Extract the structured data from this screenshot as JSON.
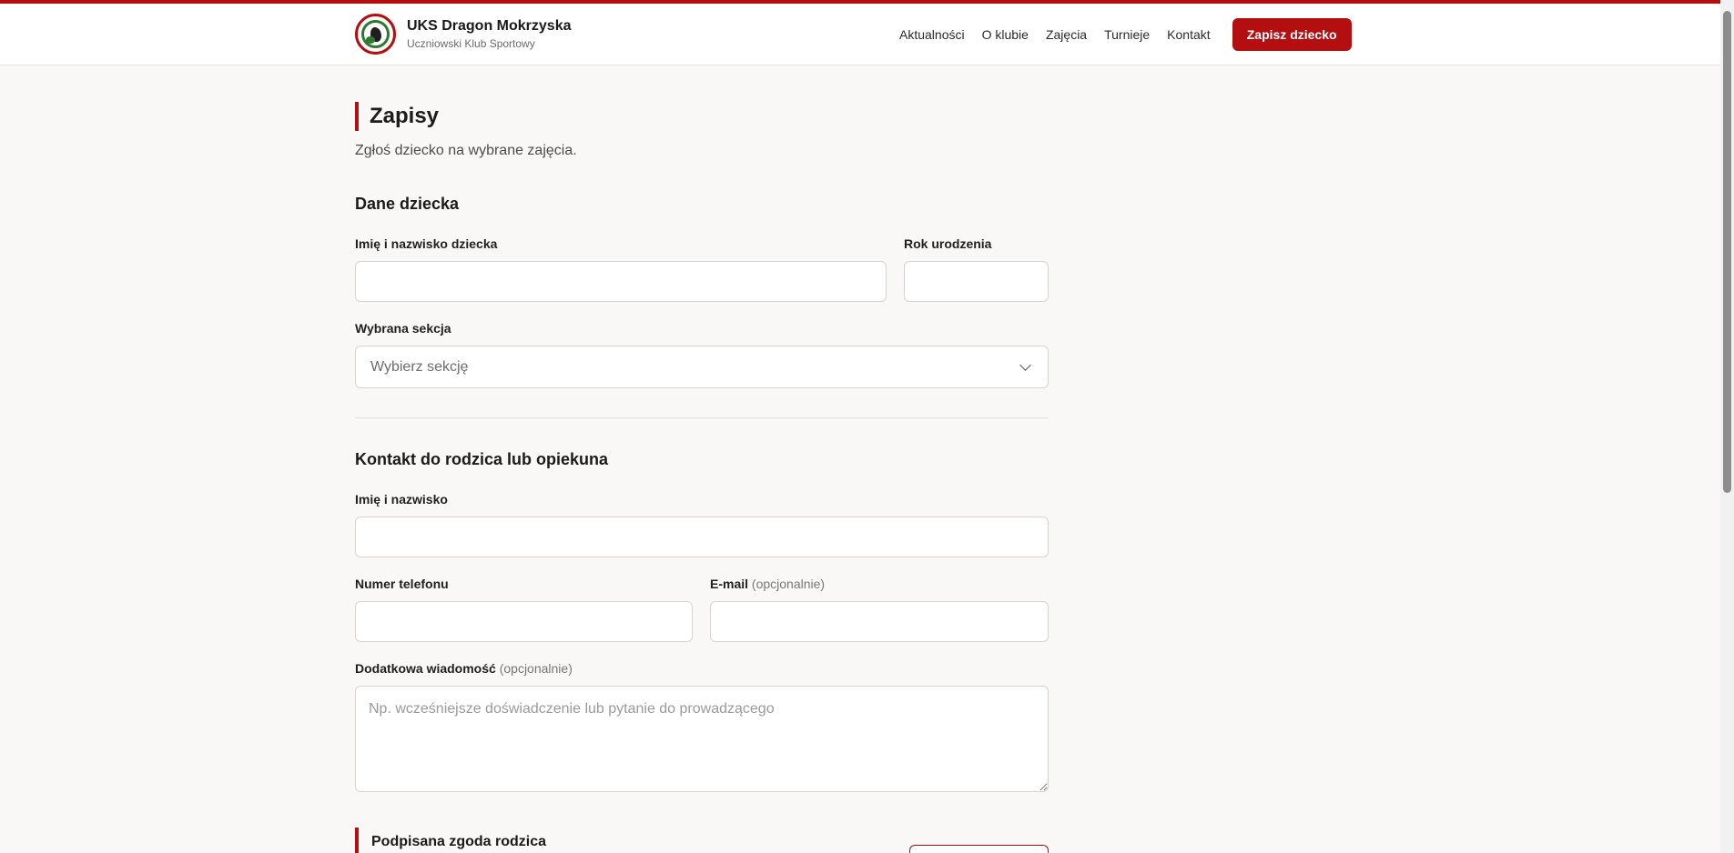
{
  "brand": {
    "title": "UKS Dragon Mokrzyska",
    "subtitle": "Uczniowski Klub Sportowy"
  },
  "nav": {
    "items": [
      "Aktualności",
      "O klubie",
      "Zajęcia",
      "Turnieje",
      "Kontakt"
    ],
    "cta": "Zapisz dziecko"
  },
  "page": {
    "title": "Zapisy",
    "subtitle": "Zgłoś dziecko na wybrane zajęcia."
  },
  "child": {
    "section_title": "Dane dziecka",
    "name_label": "Imię i nazwisko dziecka",
    "name_value": "",
    "year_label": "Rok urodzenia",
    "year_value": "",
    "section_label": "Wybrana sekcja",
    "section_value": "Wybierz sekcję"
  },
  "parent": {
    "section_title": "Kontakt do rodzica lub opiekuna",
    "name_label": "Imię i nazwisko",
    "name_value": "",
    "phone_label": "Numer telefonu",
    "phone_value": "",
    "email_label": "E-mail",
    "email_optional": "(opcjonalnie)",
    "email_value": "",
    "message_label": "Dodatkowa wiadomość",
    "message_optional": "(opcjonalnie)",
    "message_placeholder": "Np. wcześniejsze doświadczenie lub pytanie do prowadzącego"
  },
  "consent": {
    "title": "Podpisana zgoda rodzica"
  },
  "colors": {
    "accent": "#b30f10",
    "background": "#f9f8f6"
  }
}
